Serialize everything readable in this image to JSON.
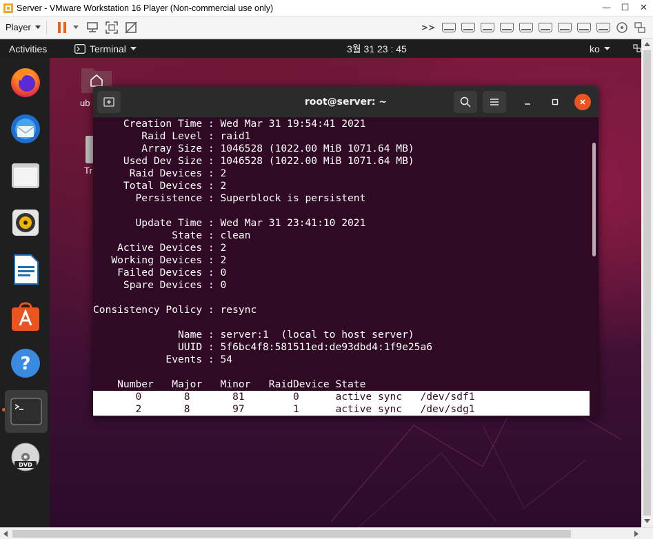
{
  "vmware": {
    "window_title": "Server - VMware Workstation 16 Player (Non-commercial use only)",
    "player_menu": "Player",
    "minimize": "—",
    "maximize": "☐",
    "close": "✕",
    "more_devices": ">>"
  },
  "ubuntu": {
    "activities": "Activities",
    "app_menu": "Terminal",
    "clock": "3월 31  23 : 45",
    "input_lang": "ko",
    "desktop_icons": [
      {
        "label": "ub"
      },
      {
        "label": "Tr"
      }
    ],
    "dock": [
      "firefox",
      "thunderbird",
      "files",
      "rhythmbox",
      "libreoffice-writer",
      "ubuntu-software",
      "help",
      "terminal",
      "dvd"
    ]
  },
  "terminal": {
    "title": "root@server: ~",
    "lines": [
      "     Creation Time : Wed Mar 31 19:54:41 2021",
      "        Raid Level : raid1",
      "        Array Size : 1046528 (1022.00 MiB 1071.64 MB)",
      "     Used Dev Size : 1046528 (1022.00 MiB 1071.64 MB)",
      "      Raid Devices : 2",
      "     Total Devices : 2",
      "       Persistence : Superblock is persistent",
      "",
      "       Update Time : Wed Mar 31 23:41:10 2021",
      "             State : clean",
      "    Active Devices : 2",
      "   Working Devices : 2",
      "    Failed Devices : 0",
      "     Spare Devices : 0",
      "",
      "Consistency Policy : resync",
      "",
      "              Name : server:1  (local to host server)",
      "              UUID : 5f6bc4f8:581511ed:de93dbd4:1f9e25a6",
      "            Events : 54",
      "",
      "    Number   Major   Minor   RaidDevice State",
      "       0       8       81        0      active sync   /dev/sdf1",
      "       2       8       97        1      active sync   /dev/sdg1"
    ]
  },
  "colors": {
    "terminal_bg": "#300a24",
    "ubuntu_orange": "#e95420",
    "topbar": "#1d1d1d"
  }
}
